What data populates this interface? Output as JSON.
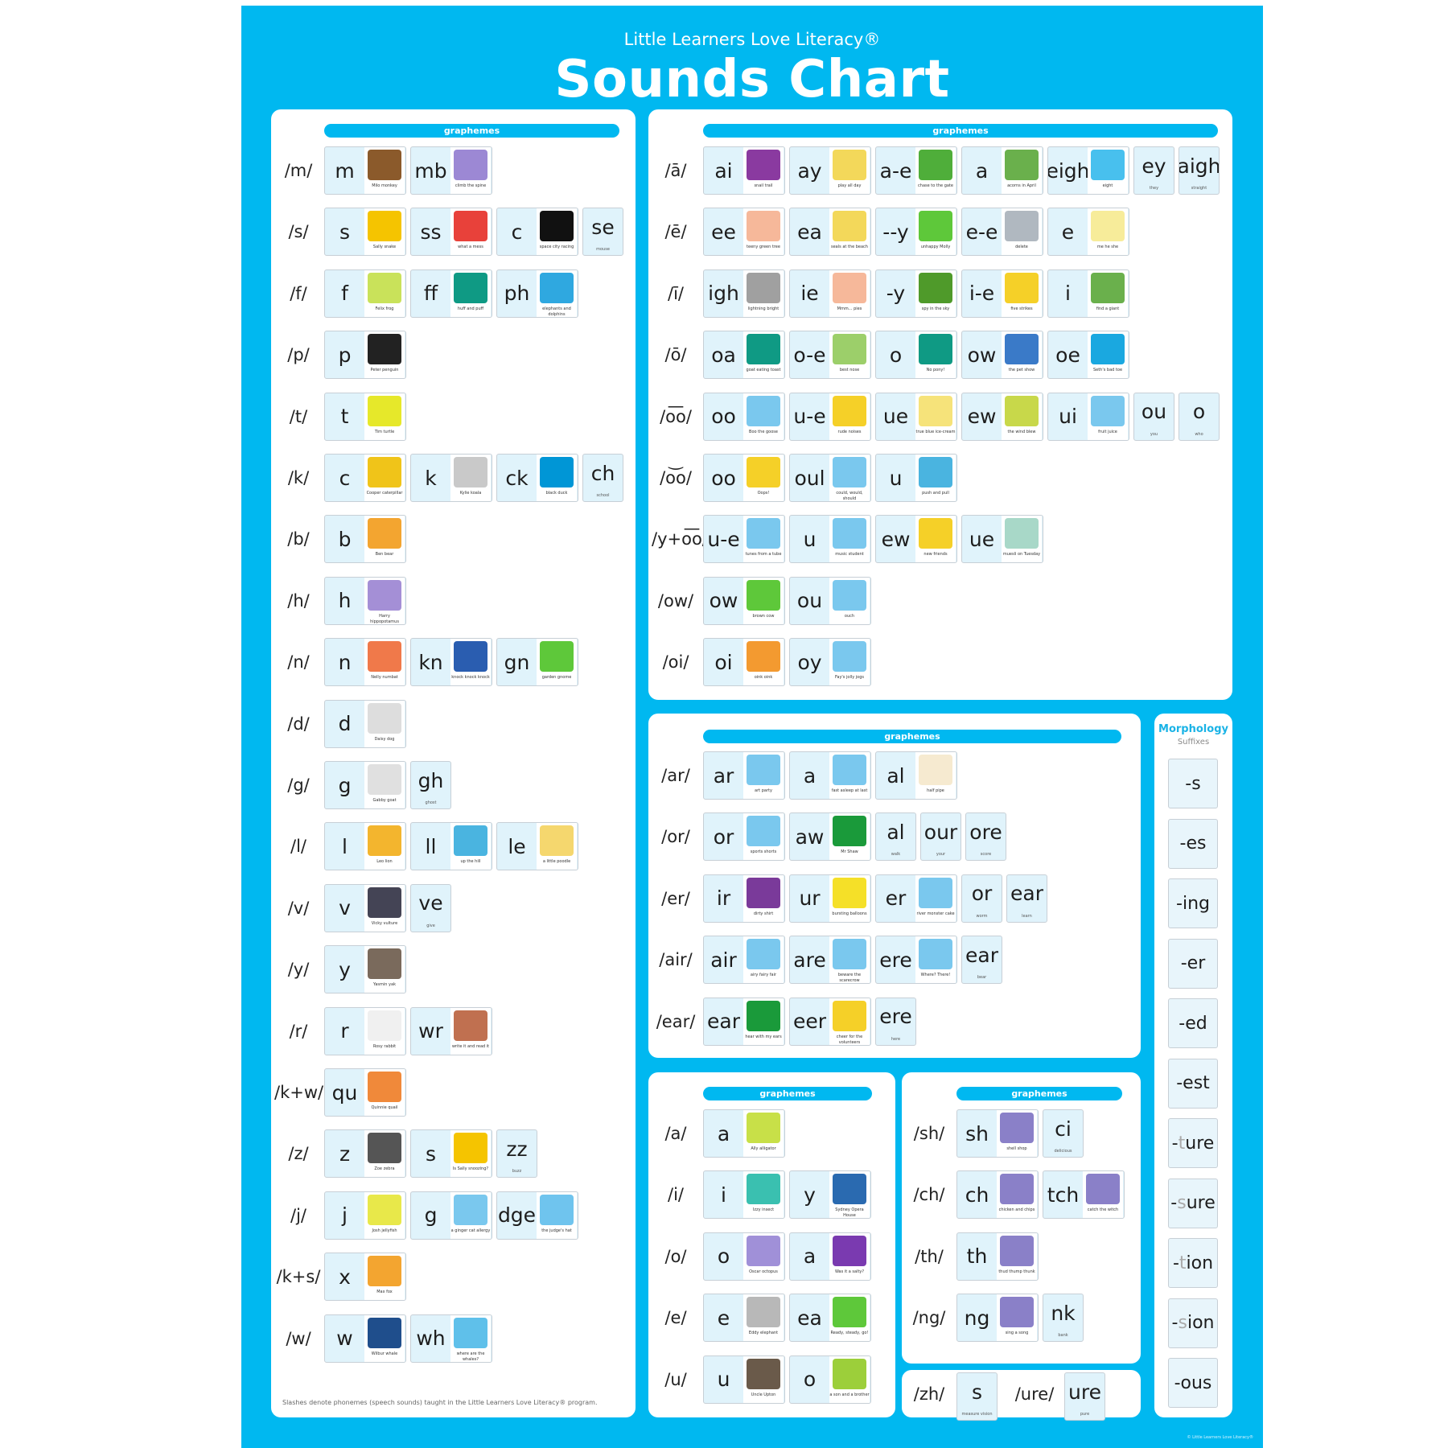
{
  "header": {
    "brand": "Little Learners Love Literacy®",
    "title": "Sounds Chart"
  },
  "colors": {
    "brand_blue": "#00b8f0",
    "tile_bg": "#e0f3fb",
    "morph_title": "#1ab3e6"
  },
  "graphemes_label": "graphemes",
  "footnote": "Slashes denote phonemes (speech sounds) taught in the Little Learners Love Literacy® program.",
  "copyright": "© Little Learners Love Literacy®",
  "consonants": [
    {
      "phoneme": "/m/",
      "tiles": [
        {
          "g": "m",
          "cap": "Milo monkey",
          "color": "#8b5a2b"
        },
        {
          "g": "mb",
          "cap": "climb the spine",
          "color": "#9c88d4"
        }
      ]
    },
    {
      "phoneme": "/s/",
      "tiles": [
        {
          "g": "s",
          "cap": "Sally snake",
          "color": "#f5c400"
        },
        {
          "g": "ss",
          "cap": "what a mess",
          "color": "#e8413a"
        },
        {
          "g": "c",
          "cap": "space city racing",
          "color": "#111111"
        },
        {
          "g": "se",
          "cap": "mouse"
        }
      ]
    },
    {
      "phoneme": "/f/",
      "tiles": [
        {
          "g": "f",
          "cap": "Felix frog",
          "color": "#c9e25a"
        },
        {
          "g": "ff",
          "cap": "huff and puff",
          "color": "#0f9a84"
        },
        {
          "g": "ph",
          "cap": "elephants and dolphins",
          "color": "#2fa8e0"
        }
      ]
    },
    {
      "phoneme": "/p/",
      "tiles": [
        {
          "g": "p",
          "cap": "Peter penguin",
          "color": "#222222"
        }
      ]
    },
    {
      "phoneme": "/t/",
      "tiles": [
        {
          "g": "t",
          "cap": "Tim turtle",
          "color": "#e6e82a"
        }
      ]
    },
    {
      "phoneme": "/k/",
      "tiles": [
        {
          "g": "c",
          "cap": "Cooper caterpillar",
          "color": "#f0c419"
        },
        {
          "g": "k",
          "cap": "Kylie koala",
          "color": "#c9c9c9"
        },
        {
          "g": "ck",
          "cap": "black duck",
          "color": "#0096d6"
        },
        {
          "g": "ch",
          "cap": "school"
        }
      ]
    },
    {
      "phoneme": "/b/",
      "tiles": [
        {
          "g": "b",
          "cap": "Ben bear",
          "color": "#f3a530"
        }
      ]
    },
    {
      "phoneme": "/h/",
      "tiles": [
        {
          "g": "h",
          "cap": "Harry hippopotamus",
          "color": "#a48fd6"
        }
      ]
    },
    {
      "phoneme": "/n/",
      "tiles": [
        {
          "g": "n",
          "cap": "Nelly numbat",
          "color": "#f0794a"
        },
        {
          "g": "kn",
          "cap": "knock knock knock",
          "color": "#2a5db0"
        },
        {
          "g": "gn",
          "cap": "garden gnome",
          "color": "#5ec83a"
        }
      ]
    },
    {
      "phoneme": "/d/",
      "tiles": [
        {
          "g": "d",
          "cap": "Daisy dog",
          "color": "#dddddd"
        }
      ]
    },
    {
      "phoneme": "/g/",
      "tiles": [
        {
          "g": "g",
          "cap": "Gabby goat",
          "color": "#e0e0e0"
        },
        {
          "g": "gh",
          "cap": "ghost"
        }
      ]
    },
    {
      "phoneme": "/l/",
      "tiles": [
        {
          "g": "l",
          "cap": "Leo lion",
          "color": "#f3b52e"
        },
        {
          "g": "ll",
          "cap": "up the hill",
          "color": "#4ab4e0"
        },
        {
          "g": "le",
          "cap": "a little poodle",
          "color": "#f5d76e"
        }
      ]
    },
    {
      "phoneme": "/v/",
      "tiles": [
        {
          "g": "v",
          "cap": "Vicky vulture",
          "color": "#444455"
        },
        {
          "g": "ve",
          "cap": "give"
        }
      ]
    },
    {
      "phoneme": "/y/",
      "tiles": [
        {
          "g": "y",
          "cap": "Yasmin yak",
          "color": "#7a6a5c"
        }
      ]
    },
    {
      "phoneme": "/r/",
      "tiles": [
        {
          "g": "r",
          "cap": "Rosy rabbit",
          "color": "#f0f0f0"
        },
        {
          "g": "wr",
          "cap": "write it and read it",
          "color": "#c07050"
        }
      ]
    },
    {
      "phoneme": "/k+w/",
      "tiles": [
        {
          "g": "qu",
          "cap": "Quinnie quail",
          "color": "#f0893a"
        }
      ]
    },
    {
      "phoneme": "/z/",
      "tiles": [
        {
          "g": "z",
          "cap": "Zoe zebra",
          "color": "#555555"
        },
        {
          "g": "s",
          "cap": "Is Sally snoozing?",
          "color": "#f5c400"
        },
        {
          "g": "zz",
          "cap": "buzz"
        }
      ]
    },
    {
      "phoneme": "/j/",
      "tiles": [
        {
          "g": "j",
          "cap": "Josh jellyfish",
          "color": "#e8e84a"
        },
        {
          "g": "g",
          "cap": "a ginger cat allergy",
          "color": "#7ac8ee"
        },
        {
          "g": "dge",
          "cap": "the judge's hat",
          "color": "#6fc4ee"
        }
      ]
    },
    {
      "phoneme": "/k+s/",
      "tiles": [
        {
          "g": "x",
          "cap": "Max fox",
          "color": "#f3a530"
        }
      ]
    },
    {
      "phoneme": "/w/",
      "tiles": [
        {
          "g": "w",
          "cap": "Wilbur whale",
          "color": "#1f4e8c"
        },
        {
          "g": "wh",
          "cap": "where are the whales?",
          "color": "#5fc0ea"
        }
      ]
    }
  ],
  "long_vowels": [
    {
      "phoneme": "/ā/",
      "tiles": [
        {
          "g": "ai",
          "cap": "snail trail",
          "color": "#8a3aa0"
        },
        {
          "g": "ay",
          "cap": "play all day",
          "color": "#f3d85a"
        },
        {
          "g": "a-e",
          "cap": "chase to the gate",
          "color": "#4fae3a"
        },
        {
          "g": "a",
          "cap": "acorns in April",
          "color": "#6ab04c"
        },
        {
          "g": "eigh",
          "cap": "eight",
          "color": "#48c0ee"
        },
        {
          "g": "ey",
          "cap": "they"
        },
        {
          "g": "aigh",
          "cap": "straight"
        }
      ]
    },
    {
      "phoneme": "/ē/",
      "tiles": [
        {
          "g": "ee",
          "cap": "teeny green tree",
          "color": "#f6b89a"
        },
        {
          "g": "ea",
          "cap": "seals at the beach",
          "color": "#f3d85a"
        },
        {
          "g": "--y",
          "cap": "unhappy Molly",
          "color": "#5ec83a"
        },
        {
          "g": "e-e",
          "cap": "delete",
          "color": "#b0b8c0"
        },
        {
          "g": "e",
          "cap": "me he she",
          "color": "#f7ec9a"
        }
      ]
    },
    {
      "phoneme": "/ī/",
      "tiles": [
        {
          "g": "igh",
          "cap": "lightning bright",
          "color": "#a0a0a0"
        },
        {
          "g": "ie",
          "cap": "Mmm... pies",
          "color": "#f6b89a"
        },
        {
          "g": "-y",
          "cap": "spy in the sky",
          "color": "#4f9a2a"
        },
        {
          "g": "i-e",
          "cap": "five strikes",
          "color": "#f5d028"
        },
        {
          "g": "i",
          "cap": "find a giant",
          "color": "#6ab04c"
        }
      ]
    },
    {
      "phoneme": "/ō/",
      "tiles": [
        {
          "g": "oa",
          "cap": "goat eating toast",
          "color": "#0f9a84"
        },
        {
          "g": "o-e",
          "cap": "best nose",
          "color": "#9ccf6a"
        },
        {
          "g": "o",
          "cap": "No pony!",
          "color": "#0f9a84"
        },
        {
          "g": "ow",
          "cap": "the pet show",
          "color": "#3a7ac8"
        },
        {
          "g": "oe",
          "cap": "Seth's bad toe",
          "color": "#1aa8e0"
        }
      ]
    },
    {
      "phoneme": "/o͞o/",
      "tiles": [
        {
          "g": "oo",
          "cap": "Boo the goose",
          "color": "#7ac8ee"
        },
        {
          "g": "u-e",
          "cap": "rude noises",
          "color": "#f5d028"
        },
        {
          "g": "ue",
          "cap": "true blue ice-cream",
          "color": "#f6e37a"
        },
        {
          "g": "ew",
          "cap": "the wind blew",
          "color": "#c8d84a"
        },
        {
          "g": "ui",
          "cap": "fruit juice",
          "color": "#7ac8ee"
        },
        {
          "g": "ou",
          "cap": "you"
        },
        {
          "g": "o",
          "cap": "who"
        }
      ]
    },
    {
      "phoneme": "/o͝o/",
      "tiles": [
        {
          "g": "oo",
          "cap": "Oops!",
          "color": "#f5d028"
        },
        {
          "g": "oul",
          "cap": "could, would, should",
          "color": "#7ac8ee"
        },
        {
          "g": "u",
          "cap": "push and pull",
          "color": "#4ab4e0"
        }
      ]
    },
    {
      "phoneme": "/y+o͞o/",
      "tiles": [
        {
          "g": "u-e",
          "cap": "tunes from a tube",
          "color": "#7ac8ee"
        },
        {
          "g": "u",
          "cap": "music student",
          "color": "#7ac8ee"
        },
        {
          "g": "ew",
          "cap": "new friends",
          "color": "#f5d028"
        },
        {
          "g": "ue",
          "cap": "muesli on Tuesday",
          "color": "#a8d8c8"
        }
      ]
    },
    {
      "phoneme": "/ow/",
      "tiles": [
        {
          "g": "ow",
          "cap": "brown cow",
          "color": "#5ec83a"
        },
        {
          "g": "ou",
          "cap": "ouch",
          "color": "#7ac8ee"
        }
      ]
    },
    {
      "phoneme": "/oi/",
      "tiles": [
        {
          "g": "oi",
          "cap": "oink oink",
          "color": "#f39a30"
        },
        {
          "g": "oy",
          "cap": "Fay's jolly jogs",
          "color": "#7ac8ee"
        }
      ]
    }
  ],
  "r_vowels": [
    {
      "phoneme": "/ar/",
      "tiles": [
        {
          "g": "ar",
          "cap": "art party",
          "color": "#7ac8ee"
        },
        {
          "g": "a",
          "cap": "fast asleep at last",
          "color": "#7ac8ee"
        },
        {
          "g": "al",
          "cap": "half pipe",
          "color": "#f6ead0"
        }
      ]
    },
    {
      "phoneme": "/or/",
      "tiles": [
        {
          "g": "or",
          "cap": "sports shorts",
          "color": "#7ac8ee"
        },
        {
          "g": "aw",
          "cap": "Mr Shaw",
          "color": "#1a9a3a"
        },
        {
          "g": "al",
          "cap": "walk"
        },
        {
          "g": "our",
          "cap": "your"
        },
        {
          "g": "ore",
          "cap": "score"
        }
      ]
    },
    {
      "phoneme": "/er/",
      "tiles": [
        {
          "g": "ir",
          "cap": "dirty shirt",
          "color": "#7a3a9a"
        },
        {
          "g": "ur",
          "cap": "bursting balloons",
          "color": "#f5e028"
        },
        {
          "g": "er",
          "cap": "river monster cake",
          "color": "#7ac8ee"
        },
        {
          "g": "or",
          "cap": "worm"
        },
        {
          "g": "ear",
          "cap": "learn"
        }
      ]
    },
    {
      "phoneme": "/air/",
      "tiles": [
        {
          "g": "air",
          "cap": "airy fairy fair",
          "color": "#7ac8ee"
        },
        {
          "g": "are",
          "cap": "beware the scarecrow",
          "color": "#7ac8ee"
        },
        {
          "g": "ere",
          "cap": "Where? There!",
          "color": "#7ac8ee"
        },
        {
          "g": "ear",
          "cap": "bear"
        }
      ]
    },
    {
      "phoneme": "/ear/",
      "tiles": [
        {
          "g": "ear",
          "cap": "hear with my ears",
          "color": "#1a9a3a"
        },
        {
          "g": "eer",
          "cap": "cheer for the volunteers",
          "color": "#f5d028"
        },
        {
          "g": "ere",
          "cap": "here"
        }
      ]
    }
  ],
  "short_vowels": [
    {
      "phoneme": "/a/",
      "tiles": [
        {
          "g": "a",
          "cap": "Ally alligator",
          "color": "#c8e048"
        }
      ]
    },
    {
      "phoneme": "/i/",
      "tiles": [
        {
          "g": "i",
          "cap": "Izzy insect",
          "color": "#3ac0b0"
        },
        {
          "g": "y",
          "cap": "Sydney Opera House",
          "color": "#2a6ab0"
        }
      ]
    },
    {
      "phoneme": "/o/",
      "tiles": [
        {
          "g": "o",
          "cap": "Oscar octopus",
          "color": "#a090d8"
        },
        {
          "g": "a",
          "cap": "Was it a salty?",
          "color": "#7a3ab0"
        }
      ]
    },
    {
      "phoneme": "/e/",
      "tiles": [
        {
          "g": "e",
          "cap": "Eddy elephant",
          "color": "#b8b8b8"
        },
        {
          "g": "ea",
          "cap": "Ready, steady, go!",
          "color": "#5ec83a"
        }
      ]
    },
    {
      "phoneme": "/u/",
      "tiles": [
        {
          "g": "u",
          "cap": "Uncle Upton",
          "color": "#6a5a4a"
        },
        {
          "g": "o",
          "cap": "a son and a brother",
          "color": "#9ccf3a"
        }
      ]
    }
  ],
  "digraphs": [
    {
      "phoneme": "/sh/",
      "tiles": [
        {
          "g": "sh",
          "cap": "shell shop",
          "color": "#8a80c8"
        },
        {
          "g": "ci",
          "cap": "delicious"
        }
      ]
    },
    {
      "phoneme": "/ch/",
      "tiles": [
        {
          "g": "ch",
          "cap": "chicken and chips",
          "color": "#8a80c8"
        },
        {
          "g": "tch",
          "cap": "catch the witch",
          "color": "#8a80c8"
        }
      ]
    },
    {
      "phoneme": "/th/",
      "tiles": [
        {
          "g": "th",
          "cap": "thud thump thunk",
          "color": "#8a80c8"
        }
      ]
    },
    {
      "phoneme": "/ng/",
      "tiles": [
        {
          "g": "ng",
          "cap": "sing a song",
          "color": "#8a80c8"
        },
        {
          "g": "nk",
          "cap": "bank"
        }
      ]
    }
  ],
  "extra": [
    {
      "phoneme": "/zh/",
      "tiles": [
        {
          "g": "s",
          "cap": "measure vision"
        }
      ]
    },
    {
      "phoneme": "/ure/",
      "tiles": [
        {
          "g": "ure",
          "cap": "pure"
        }
      ]
    }
  ],
  "morphology": {
    "title": "Morphology",
    "subtitle": "Suffixes",
    "suffixes": [
      {
        "dash": "-",
        "dim": "",
        "rest": "s"
      },
      {
        "dash": "-",
        "dim": "",
        "rest": "es"
      },
      {
        "dash": "-",
        "dim": "",
        "rest": "ing"
      },
      {
        "dash": "-",
        "dim": "",
        "rest": "er"
      },
      {
        "dash": "-",
        "dim": "",
        "rest": "ed"
      },
      {
        "dash": "-",
        "dim": "",
        "rest": "est"
      },
      {
        "dash": "-",
        "dim": "t",
        "rest": "ure"
      },
      {
        "dash": "-",
        "dim": "s",
        "rest": "ure"
      },
      {
        "dash": "-",
        "dim": "t",
        "rest": "ion"
      },
      {
        "dash": "-",
        "dim": "s",
        "rest": "ion"
      },
      {
        "dash": "-",
        "dim": "",
        "rest": "ous"
      }
    ]
  }
}
